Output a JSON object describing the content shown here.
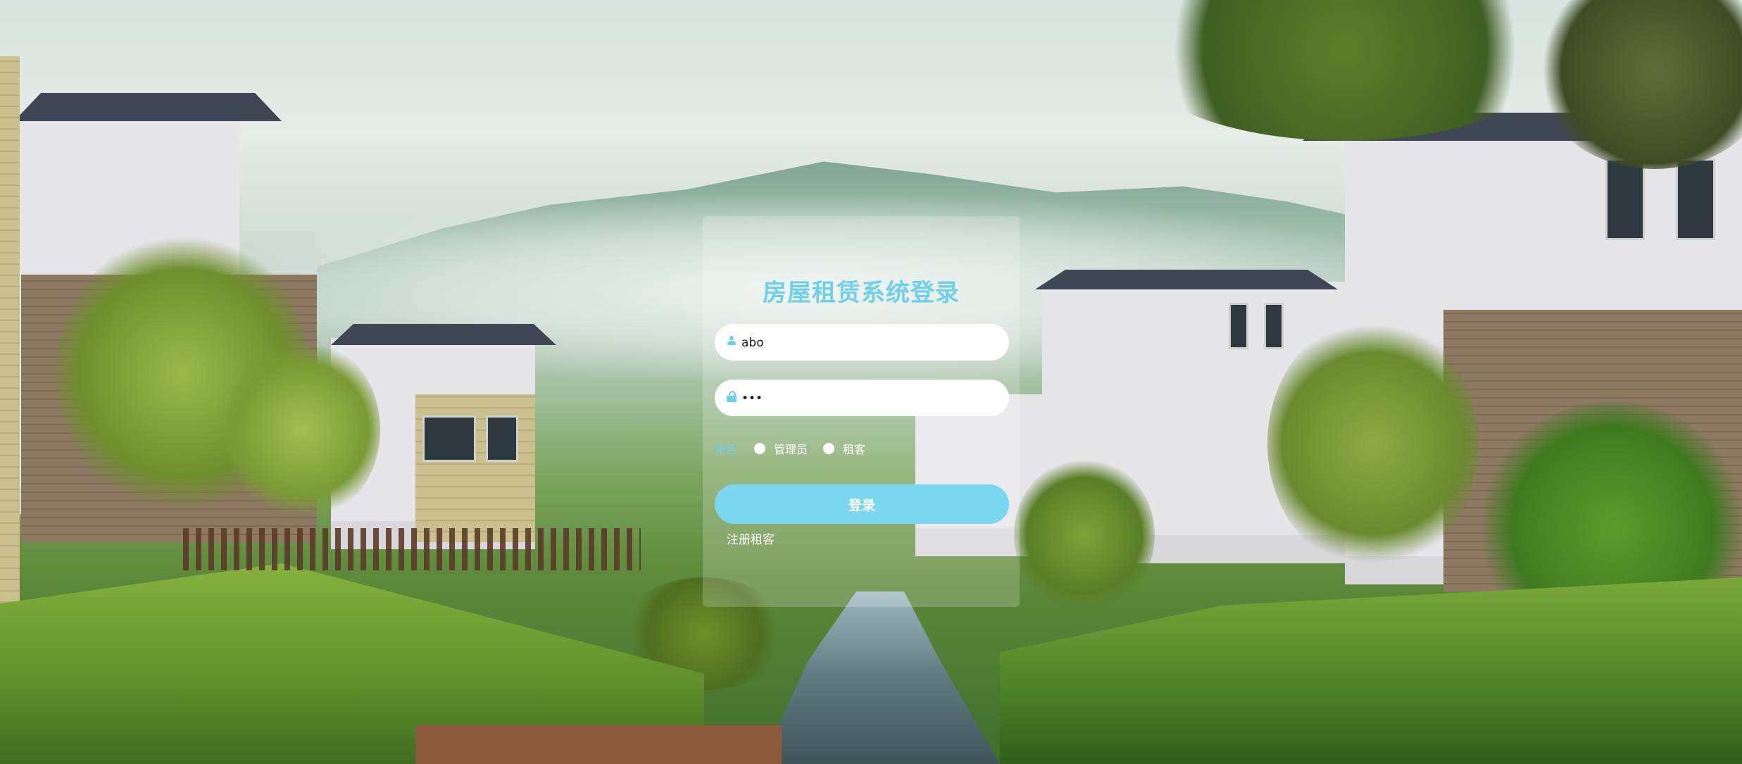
{
  "login": {
    "title": "房屋租赁系统登录",
    "username_value": "abo",
    "password_value": "•••",
    "role_label": "角色",
    "roles": [
      {
        "label": "管理员"
      },
      {
        "label": "租客"
      }
    ],
    "login_button": "登录",
    "register_link": "注册租客"
  },
  "colors": {
    "accent": "#6fd0ec",
    "button": "#7ad7ef"
  },
  "icons": {
    "username": "user-icon",
    "password": "lock-icon"
  }
}
